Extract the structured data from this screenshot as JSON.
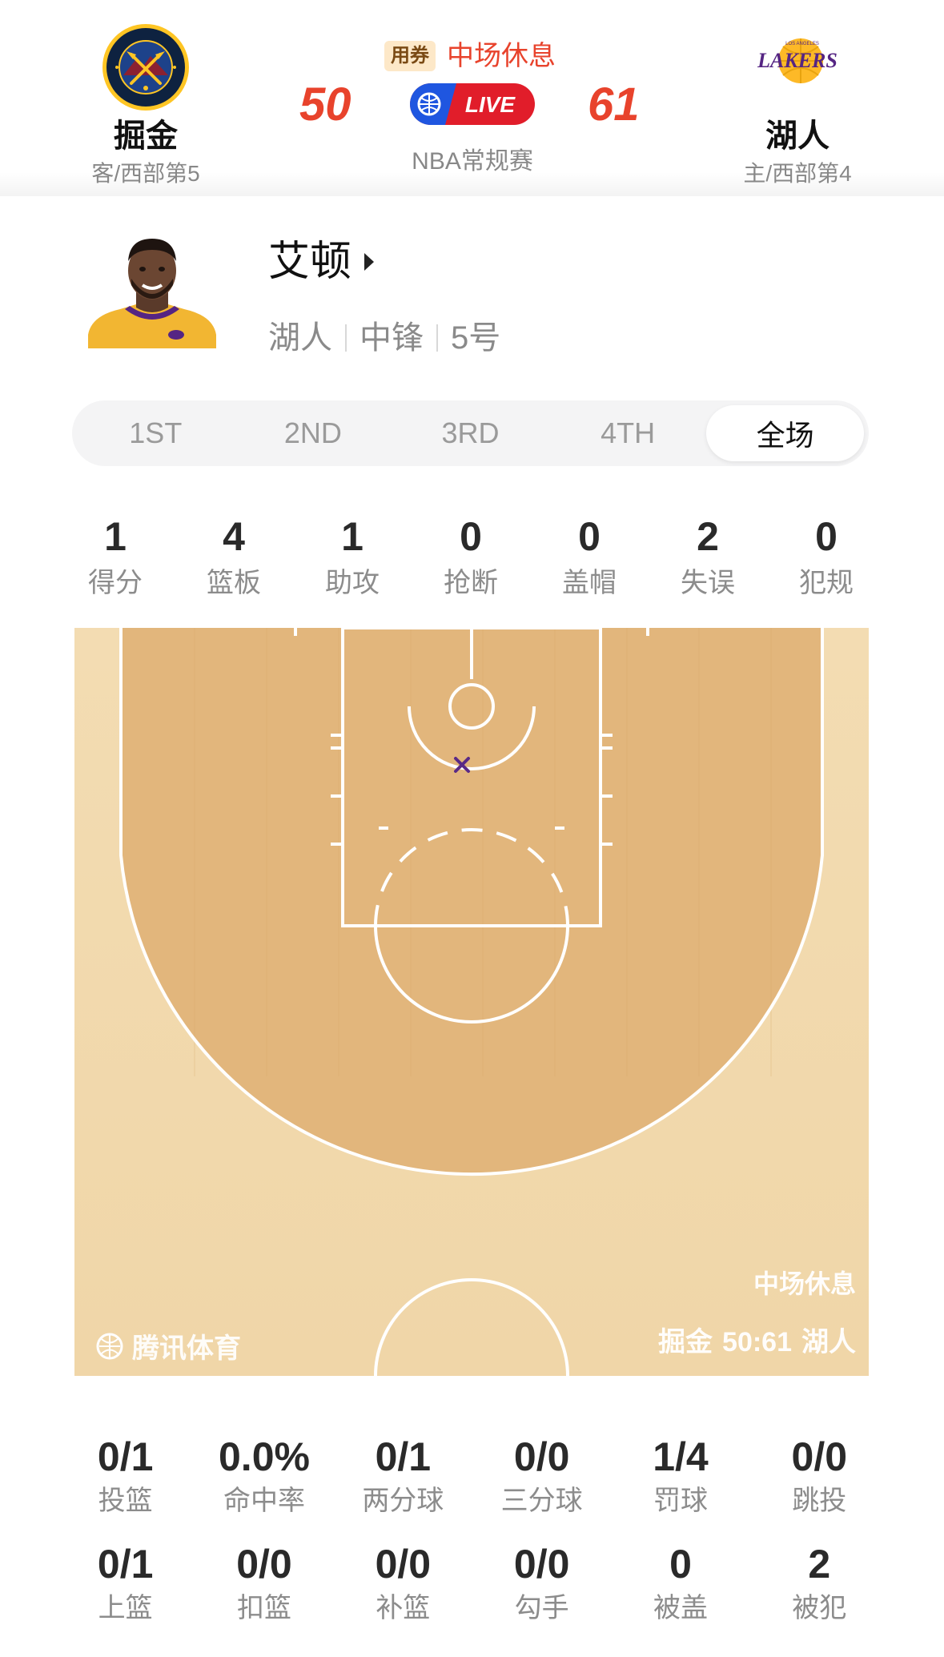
{
  "game": {
    "away": {
      "name": "掘金",
      "rank": "客/西部第5",
      "score": "50",
      "logo_icon": "denver-nuggets-logo",
      "logo_colors": {
        "navy": "#0e2240",
        "gold": "#fec524"
      }
    },
    "home": {
      "name": "湖人",
      "rank": "主/西部第4",
      "score": "61",
      "logo_icon": "los-angeles-lakers-logo",
      "logo_colors": {
        "purple": "#552583",
        "gold": "#fdb927"
      }
    },
    "coupon_label": "用券",
    "status": "中场休息",
    "live_label": "LIVE",
    "league": "NBA常规赛"
  },
  "player": {
    "name": "艾顿",
    "team": "湖人",
    "position": "中锋",
    "number": "5号",
    "photo_icon": "player-headshot"
  },
  "tabs": {
    "items": [
      "1ST",
      "2ND",
      "3RD",
      "4TH",
      "全场"
    ],
    "active": "全场"
  },
  "summary": [
    {
      "value": "1",
      "label": "得分"
    },
    {
      "value": "4",
      "label": "篮板"
    },
    {
      "value": "1",
      "label": "助攻"
    },
    {
      "value": "0",
      "label": "抢断"
    },
    {
      "value": "0",
      "label": "盖帽"
    },
    {
      "value": "2",
      "label": "失误"
    },
    {
      "value": "0",
      "label": "犯规"
    }
  ],
  "court": {
    "shots": [
      {
        "result": "miss",
        "marker": "x"
      }
    ],
    "status_text": "中场休息",
    "score_away_name": "掘金",
    "score_text": "50:61",
    "score_home_name": "湖人",
    "watermark": "腾讯体育",
    "colors": {
      "wood_light": "#f1d8ae",
      "wood_dark": "#e0b57d",
      "miss_marker": "#5a2a86"
    }
  },
  "details": [
    {
      "value": "0/1",
      "label": "投篮"
    },
    {
      "value": "0.0%",
      "label": "命中率"
    },
    {
      "value": "0/1",
      "label": "两分球"
    },
    {
      "value": "0/0",
      "label": "三分球"
    },
    {
      "value": "1/4",
      "label": "罚球"
    },
    {
      "value": "0/0",
      "label": "跳投"
    },
    {
      "value": "0/1",
      "label": "上篮"
    },
    {
      "value": "0/0",
      "label": "扣篮"
    },
    {
      "value": "0/0",
      "label": "补篮"
    },
    {
      "value": "0/0",
      "label": "勾手"
    },
    {
      "value": "0",
      "label": "被盖"
    },
    {
      "value": "2",
      "label": "被犯"
    }
  ]
}
